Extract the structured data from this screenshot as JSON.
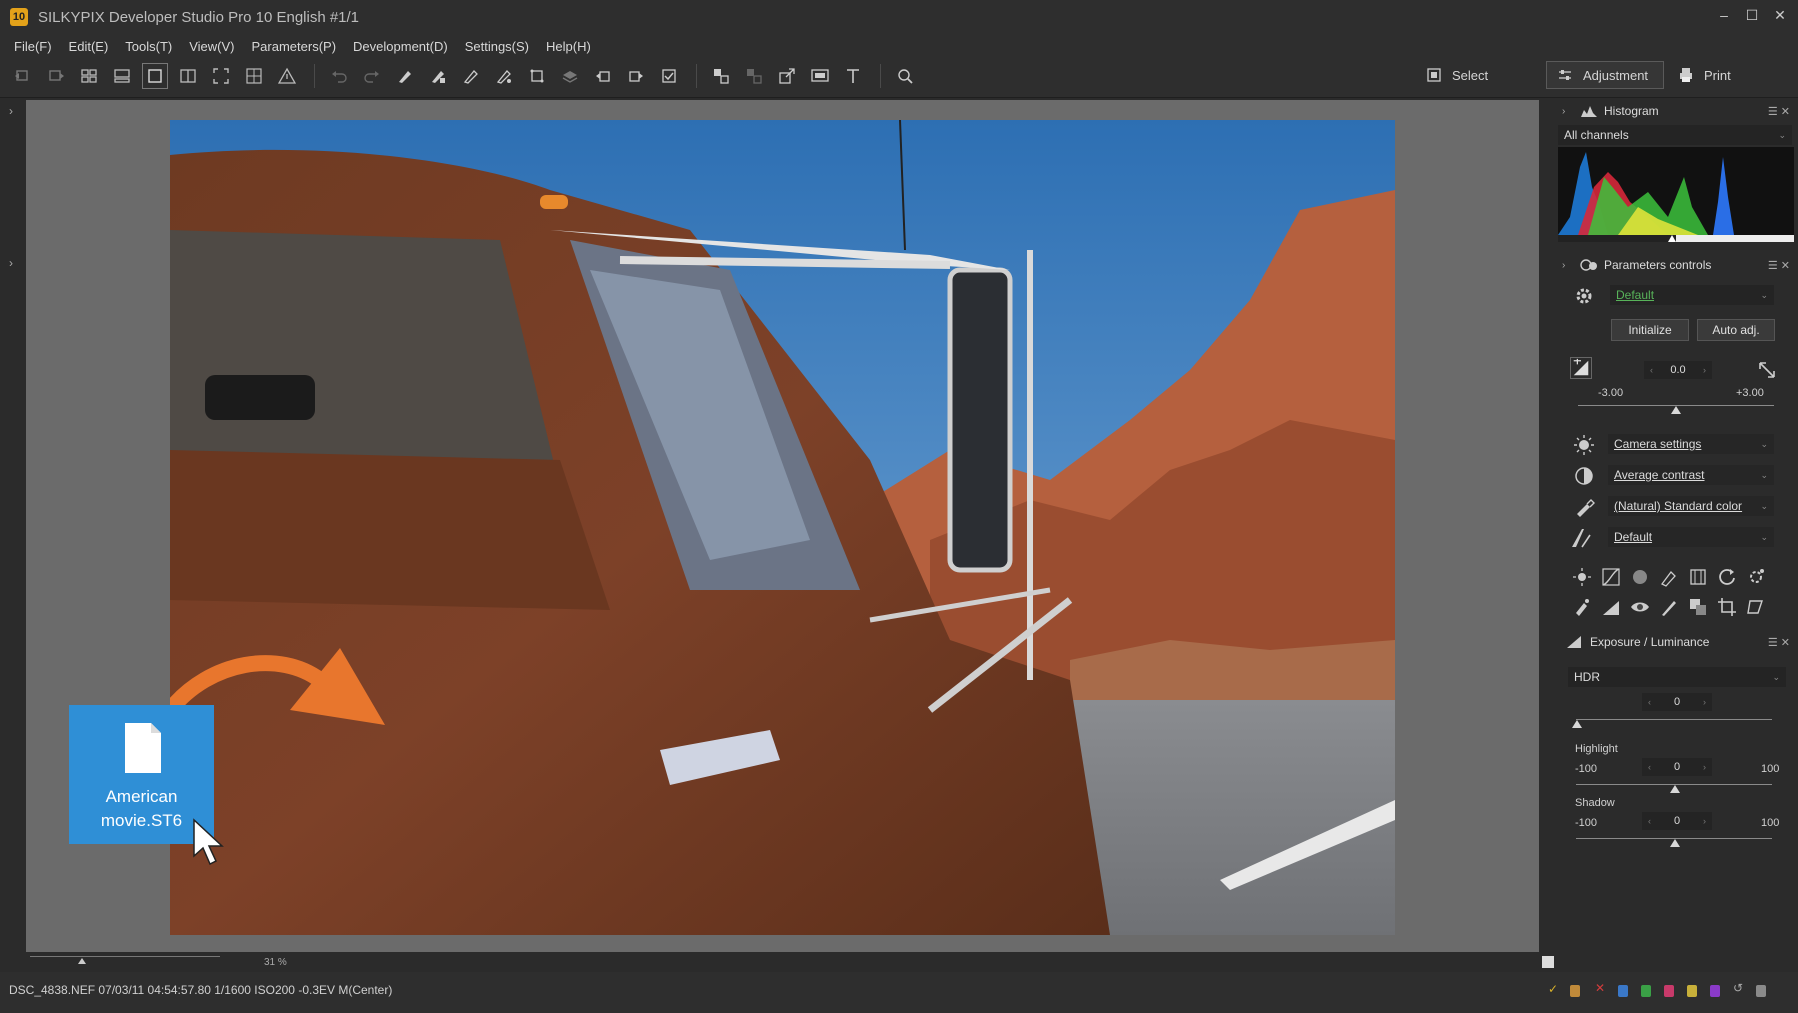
{
  "window": {
    "title": "SILKYPIX Developer Studio Pro 10 English   #1/1",
    "logo_text": "10"
  },
  "menu": {
    "items": [
      "File(F)",
      "Edit(E)",
      "Tools(T)",
      "View(V)",
      "Parameters(P)",
      "Development(D)",
      "Settings(S)",
      "Help(H)"
    ]
  },
  "modes": {
    "select": "Select",
    "adjustment": "Adjustment",
    "print": "Print"
  },
  "drop_file": {
    "name_line1": "American",
    "name_line2": "movie.ST6"
  },
  "viewer": {
    "zoom_value": "31",
    "zoom_unit": "%"
  },
  "status": {
    "info": "DSC_4838.NEF 07/03/11 04:54:57.80 1/1600 ISO200 -0.3EV M(Center)"
  },
  "histogram": {
    "title": "Histogram",
    "channel": "All channels"
  },
  "params": {
    "title": "Parameters controls",
    "preset": "Default",
    "initialize": "Initialize",
    "auto_adj": "Auto adj.",
    "exposure_value": "0.0",
    "exposure_min": "-3.00",
    "exposure_max": "+3.00",
    "exposure_level": 0.0,
    "white_balance": "Camera settings",
    "contrast": "Average contrast",
    "color": "(Natural) Standard color",
    "sharpness": "Default"
  },
  "exposure_luminance": {
    "title": "Exposure / Luminance",
    "hdr_label": "HDR",
    "hdr_value": "0",
    "highlight_label": "Highlight",
    "highlight_min": "-100",
    "highlight_max": "100",
    "highlight_value": "0",
    "shadow_label": "Shadow",
    "shadow_min": "-100",
    "shadow_max": "100",
    "shadow_value": "0"
  },
  "colors": {
    "accent_orange": "#e8762d",
    "file_blue": "#2f8fd6",
    "preset_green": "#58b35a"
  }
}
